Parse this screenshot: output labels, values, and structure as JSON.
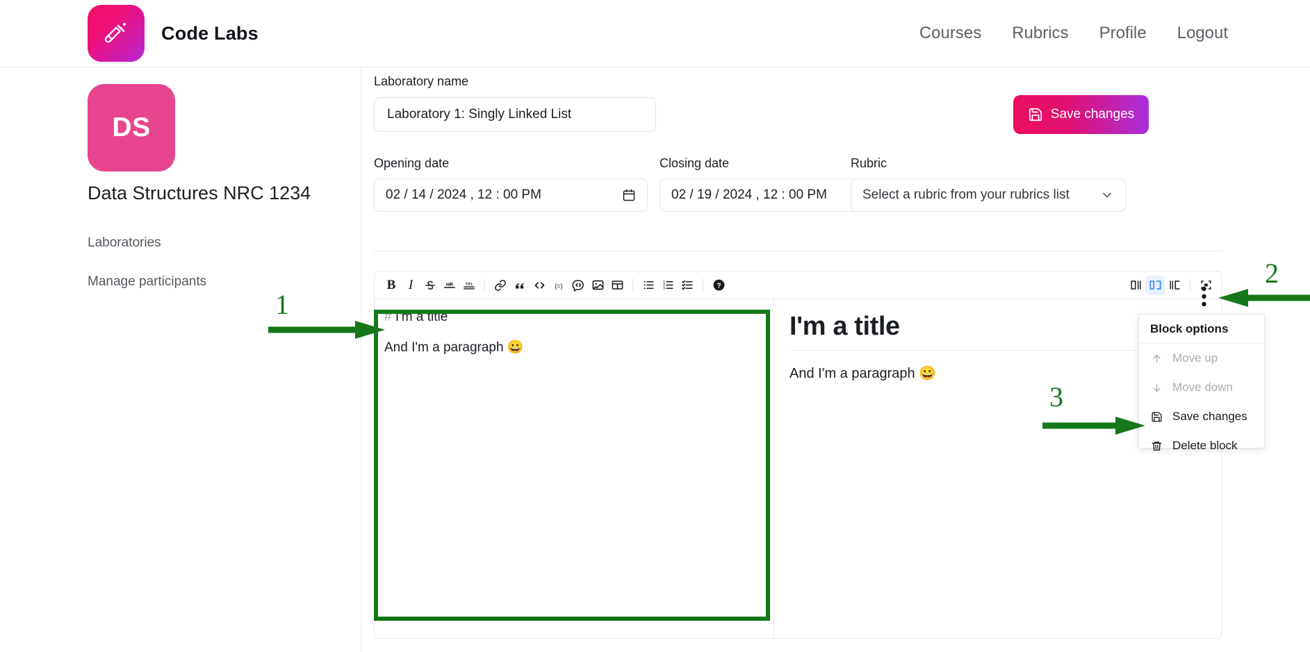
{
  "header": {
    "brand": "Code Labs",
    "logo_icon": "test-tube-icon",
    "nav": [
      {
        "label": "Courses"
      },
      {
        "label": "Rubrics"
      },
      {
        "label": "Profile"
      },
      {
        "label": "Logout"
      }
    ]
  },
  "sidebar": {
    "avatar_initials": "DS",
    "avatar_color": "#e8458f",
    "course_title": "Data Structures NRC 1234",
    "items": [
      {
        "label": "Laboratories"
      },
      {
        "label": "Manage participants"
      }
    ]
  },
  "form": {
    "lab_name_label": "Laboratory name",
    "lab_name_value": "Laboratory 1: Singly Linked List",
    "lab_name_placeholder": "Laboratory name",
    "opening_date_label": "Opening date",
    "opening_date_value": "02 / 14 / 2024 , 12 : 00  PM",
    "closing_date_label": "Closing date",
    "closing_date_value": "02 / 19 / 2024 , 12 : 00  PM",
    "rubric_label": "Rubric",
    "rubric_selected": "Select a rubric from your rubrics list",
    "save_button": "Save changes",
    "save_icon": "floppy-disk-icon",
    "calendar_icon": "calendar-icon",
    "chevron_icon": "chevron-down-icon"
  },
  "editor": {
    "toolbar": [
      {
        "name": "bold-icon",
        "glyph": "B"
      },
      {
        "name": "italic-icon",
        "glyph": "I"
      },
      {
        "name": "strikethrough-icon",
        "glyph": "S"
      },
      {
        "name": "horizontal-rule-icon",
        "glyph": "HR"
      },
      {
        "name": "title-icon",
        "glyph": "TITL"
      },
      {
        "name": "link-icon",
        "glyph": "link"
      },
      {
        "name": "blockquote-icon",
        "glyph": "”"
      },
      {
        "name": "inline-code-icon",
        "glyph": "</>"
      },
      {
        "name": "code-inline-braces-icon",
        "glyph": "{=}"
      },
      {
        "name": "code-block-icon",
        "glyph": "<>"
      },
      {
        "name": "image-icon",
        "glyph": "image"
      },
      {
        "name": "table-icon",
        "glyph": "table"
      },
      {
        "name": "bullet-list-icon",
        "glyph": "list"
      },
      {
        "name": "ordered-list-icon",
        "glyph": "1."
      },
      {
        "name": "task-list-icon",
        "glyph": "check"
      },
      {
        "name": "help-icon",
        "glyph": "?"
      }
    ],
    "view_modes": [
      {
        "name": "editor-only-view-icon",
        "active": false
      },
      {
        "name": "split-view-icon",
        "active": true
      },
      {
        "name": "preview-only-view-icon",
        "active": false
      }
    ],
    "fullscreen_icon": "fullscreen-icon",
    "more_options_icon": "vertical-dots-icon",
    "source": {
      "line1_marker": "#",
      "line1_text": "I'm a title",
      "line2_text": "And I'm a paragraph 😀"
    },
    "preview": {
      "heading": "I'm a title",
      "paragraph": "And I'm a paragraph 😀"
    }
  },
  "block_menu": {
    "title": "Block options",
    "items": [
      {
        "label": "Move up",
        "icon": "arrow-up-icon",
        "disabled": true
      },
      {
        "label": "Move down",
        "icon": "arrow-down-icon",
        "disabled": true
      },
      {
        "label": "Save changes",
        "icon": "floppy-disk-icon",
        "disabled": false
      },
      {
        "label": "Delete block",
        "icon": "trash-icon",
        "disabled": false
      }
    ]
  },
  "annotations": {
    "color": "#15771a",
    "markers": [
      {
        "label": "1"
      },
      {
        "label": "2"
      },
      {
        "label": "3"
      }
    ]
  }
}
